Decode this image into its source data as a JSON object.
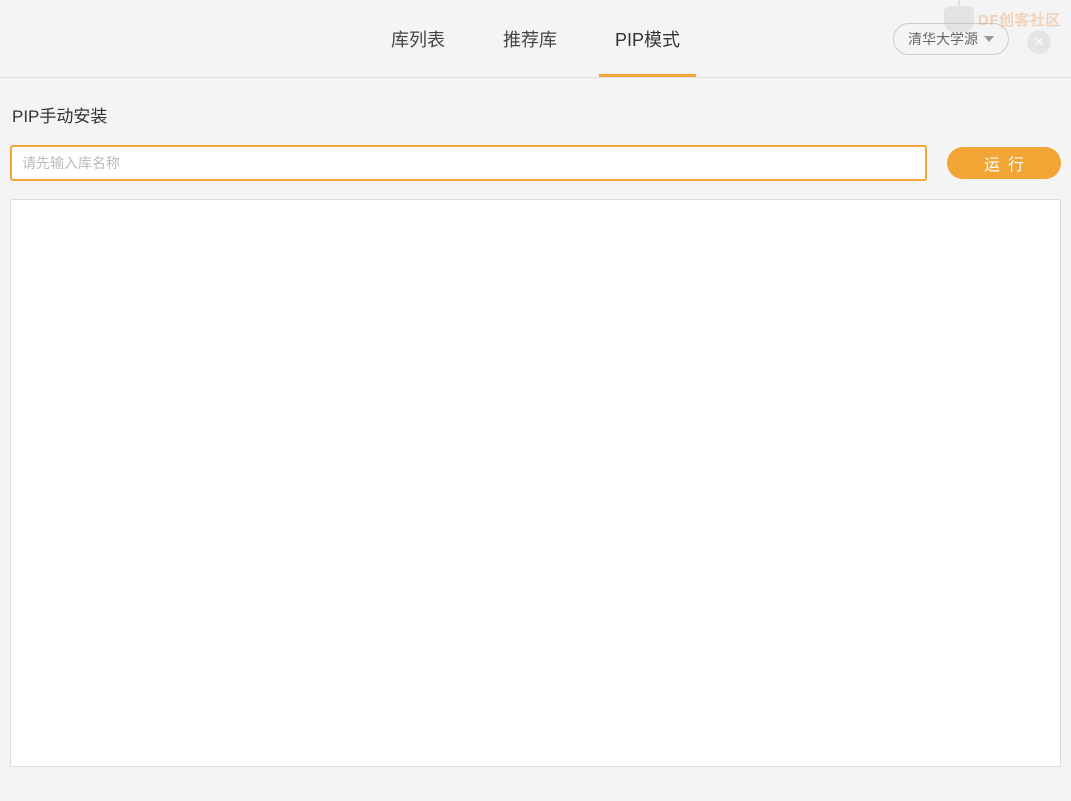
{
  "watermark": {
    "label": "DF创客社区"
  },
  "header": {
    "tabs": [
      {
        "label": "库列表",
        "active": false
      },
      {
        "label": "推荐库",
        "active": false
      },
      {
        "label": "PIP模式",
        "active": true
      }
    ],
    "source_selector": {
      "selected": "清华大学源"
    }
  },
  "main": {
    "section_title": "PIP手动安装",
    "input": {
      "placeholder": "请先输入库名称",
      "value": ""
    },
    "run_button_label": "运行",
    "output": ""
  }
}
